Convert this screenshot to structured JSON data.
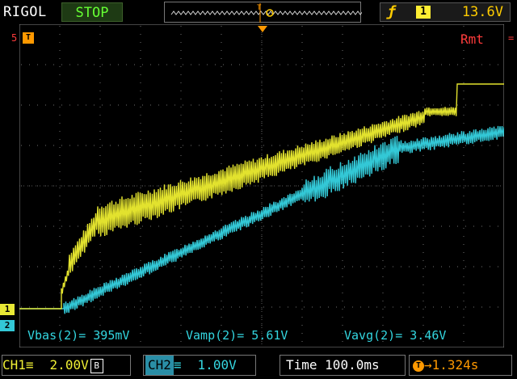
{
  "header": {
    "brand": "RIGOL",
    "run_state": "STOP",
    "trigger": {
      "edge_icon": "rising-edge-icon",
      "source": "1",
      "level": "13.6V"
    }
  },
  "markers": {
    "trigger_pos": "T",
    "ref_level": "5",
    "remote": "Rmt",
    "ch1": "1",
    "ch2": "2"
  },
  "measurements": {
    "vbase": "Vbas(2)= 395mV",
    "vamp": "Vamp(2)= 5.61V",
    "vavg": "Vavg(2)= 3.46V"
  },
  "footer": {
    "ch1_label": "CH1",
    "ch1_scale": "2.00V",
    "ch1_bw": "B",
    "ch2_label": "CH2",
    "ch2_scale": "1.00V",
    "time_label": "Time",
    "time_scale": "100.0ms",
    "offset_value": "1.324s"
  },
  "colors": {
    "ch1": "#e8e835",
    "ch2": "#33c8d6",
    "trigger": "#ff9900",
    "remote": "#ff3b3b"
  }
}
